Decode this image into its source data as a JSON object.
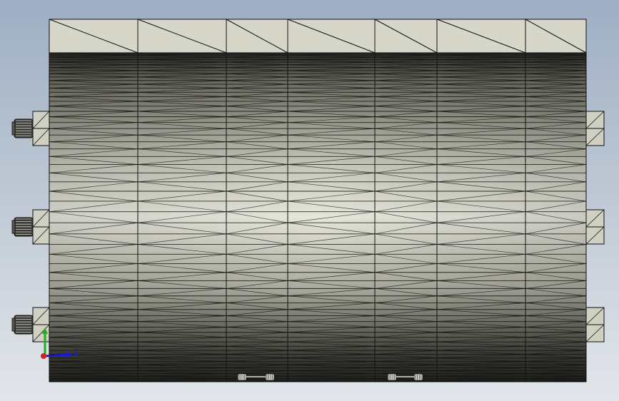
{
  "viewport": {
    "background_top": "#9eaec3",
    "background_bottom": "#e2e6ea"
  },
  "model": {
    "top_face_color": "#d6d6c9",
    "body_light": "#e6e6db",
    "body_dark": "#2a2a26",
    "edge_color": "#111111"
  },
  "triad": {
    "axis_x_color": "#1a1ad6",
    "axis_y_color": "#19b219",
    "origin_color": "#d42020",
    "z_label": "Z",
    "icon": "coordinate-triad-icon"
  }
}
